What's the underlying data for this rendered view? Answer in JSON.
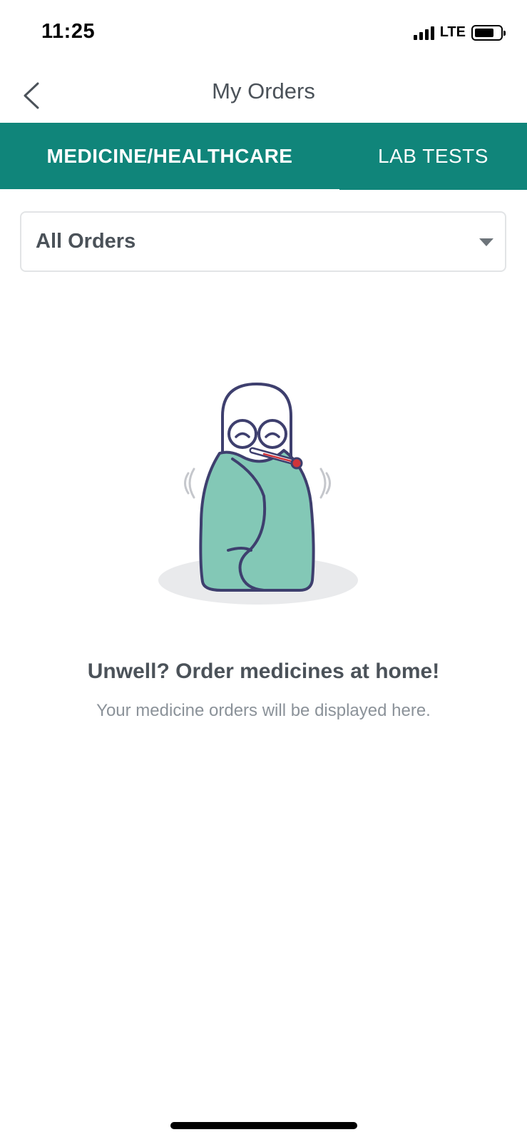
{
  "status_bar": {
    "time": "11:25",
    "network": "LTE",
    "icons": [
      "signal-bars-icon",
      "battery-icon"
    ]
  },
  "header": {
    "title": "My Orders",
    "back_icon": "chevron-left-icon"
  },
  "tabs": [
    {
      "label": "MEDICINE/HEALTHCARE",
      "active": true
    },
    {
      "label": "LAB TESTS",
      "active": false
    }
  ],
  "filter": {
    "selected": "All Orders",
    "icon": "caret-down-icon"
  },
  "empty_state": {
    "illustration": "sick-pill-mascot-with-thermometer",
    "title": "Unwell? Order medicines at home!",
    "subtitle": "Your medicine orders will be displayed here."
  },
  "colors": {
    "accent": "#10857a",
    "text": "#4b5259",
    "muted_text": "#8b9299",
    "blanket": "#83c8b6",
    "outline": "#3e3f6e"
  }
}
